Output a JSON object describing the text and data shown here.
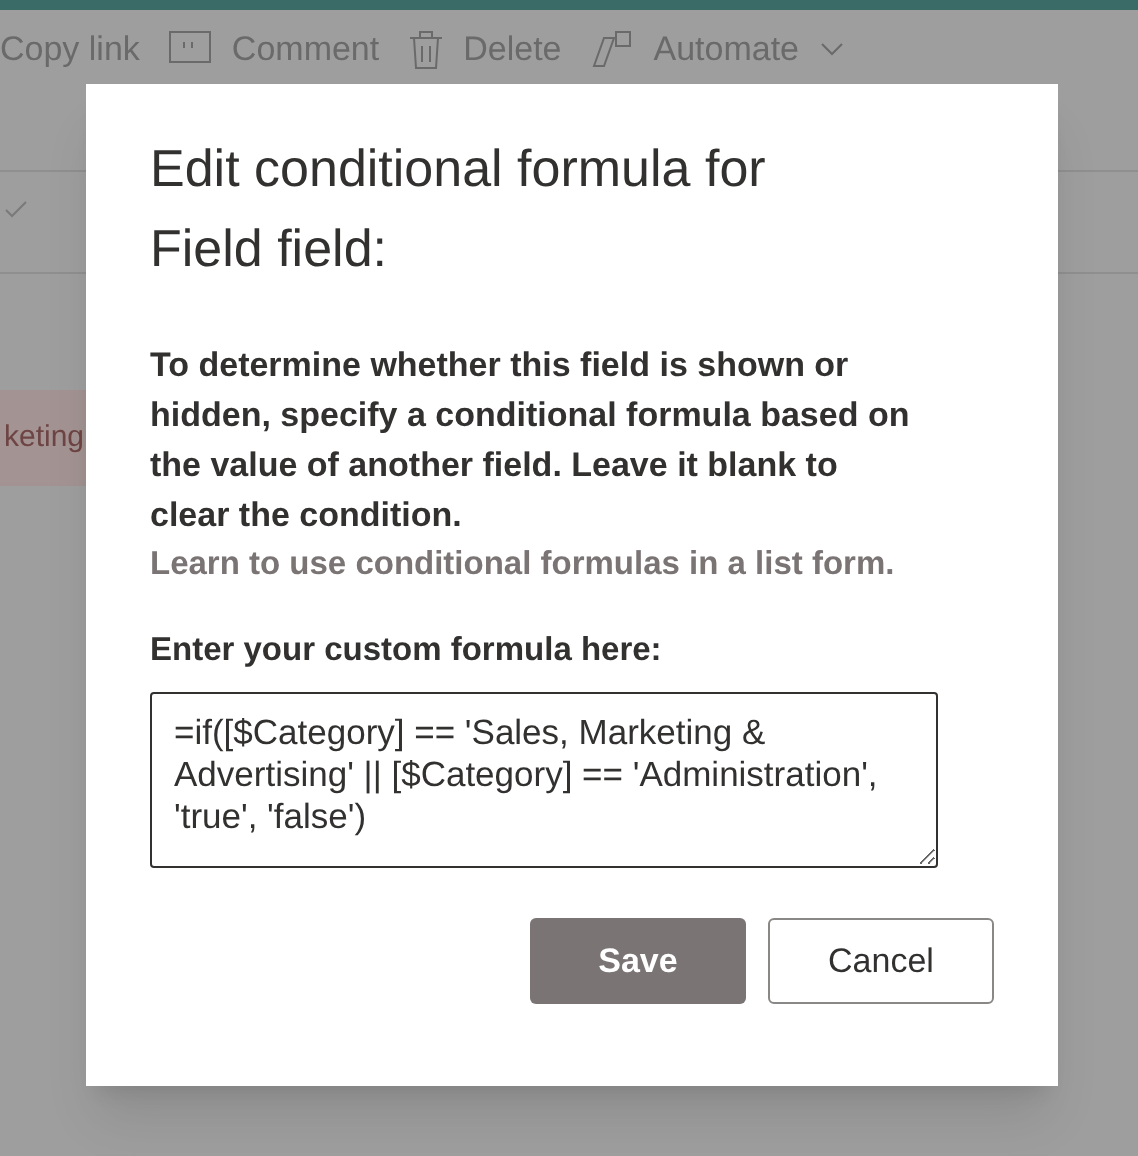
{
  "toolbar": [
    {
      "label": "Copy link",
      "kind": "link"
    },
    {
      "label": "Comment",
      "kind": "comment"
    },
    {
      "label": "Delete",
      "kind": "delete"
    },
    {
      "label": "Automate",
      "kind": "automate"
    }
  ],
  "background_row": {
    "text": "keting"
  },
  "dialog": {
    "title": "Edit conditional formula for Field field:",
    "description": "To determine whether this field is shown or hidden, specify a conditional formula based on the value of another field. Leave it blank to clear the condition.",
    "link": "Learn to use conditional formulas in a list form.",
    "field_label": "Enter your custom formula here:",
    "formula": "=if([$Category] == 'Sales, Marketing & Advertising' || [$Category] == 'Administration', 'true', 'false')",
    "buttons": [
      {
        "label": "Save",
        "kind": "primary"
      },
      {
        "label": "Cancel",
        "kind": "secondary"
      }
    ]
  }
}
